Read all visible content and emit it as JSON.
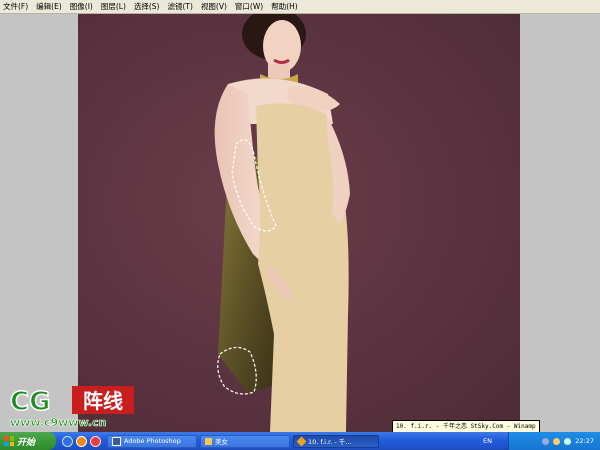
{
  "menu": [
    "文件(F)",
    "编辑(E)",
    "图像(I)",
    "图层(L)",
    "选择(S)",
    "滤镜(T)",
    "视图(V)",
    "窗口(W)",
    "帮助(H)"
  ],
  "tooltip": "10. f.i.r. - 千年之恋 StSky.Com - Winamp",
  "watermark": {
    "logo_text": "CG阵线",
    "url_text": "www.c9www.cn"
  },
  "taskbar": {
    "start_label": "开始",
    "tasks": [
      {
        "label": "Adobe Photoshop",
        "icon": "photoshop-icon"
      },
      {
        "label": "美女",
        "icon": "folder-icon"
      },
      {
        "label": "10. f.i.r. - 千...",
        "icon": "winamp-icon"
      }
    ],
    "quicklaunch": [
      "browser-icon",
      "media-icon",
      "messenger-icon"
    ],
    "tray_lang": "EN",
    "clock": "22:27"
  },
  "colors": {
    "canvas_bg": "#5a3340",
    "dress": "#e6cfa3",
    "skin": "#f3d7c8",
    "taskbar": "#245edb",
    "start_green": "#3b9a38"
  }
}
